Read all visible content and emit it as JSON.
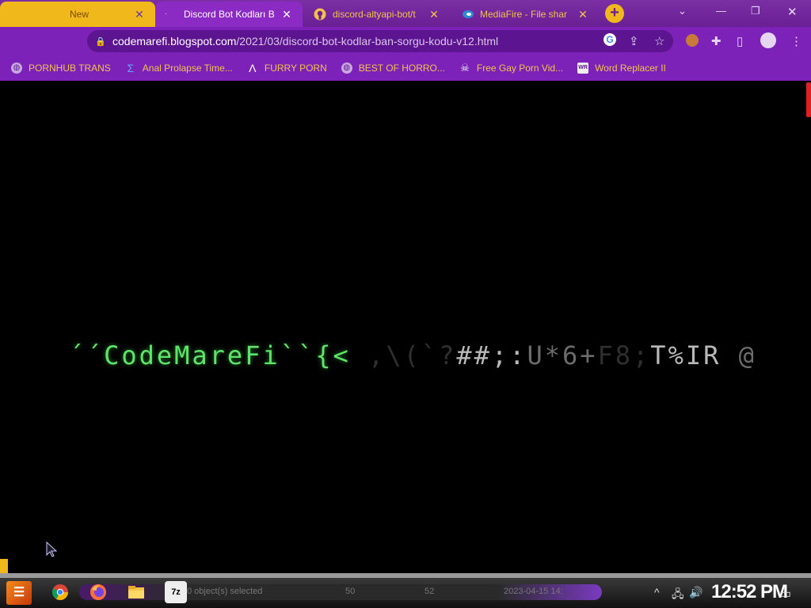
{
  "browser": {
    "tabs": [
      {
        "title": "New",
        "active": false
      },
      {
        "title": "Discord Bot Kodları B",
        "active": true
      },
      {
        "title": "discord-altyapi-bot/t",
        "active": false
      },
      {
        "title": "MediaFire - File shar",
        "active": false
      }
    ],
    "new_tab_symbol": "+",
    "close_symbol": "✕",
    "address": {
      "domain": "codemarefi.blogspot.com",
      "path": "/2021/03/discord-bot-kodlar-ban-sorgu-kodu-v12.html"
    },
    "bookmarks": [
      {
        "label": "PORNHUB TRANS",
        "icon": "globe-icon"
      },
      {
        "label": "Anal Prolapse Time...",
        "icon": "sigma-icon"
      },
      {
        "label": "FURRY PORN",
        "icon": "lambda-icon"
      },
      {
        "label": "BEST OF HORRO...",
        "icon": "globe-icon"
      },
      {
        "label": "Free Gay Porn Vid...",
        "icon": "skull-icon"
      },
      {
        "label": "Word Replacer II",
        "icon": "wr-icon"
      }
    ]
  },
  "page": {
    "code_segments": [
      {
        "text": "´´CodeMareFi``{<",
        "tone": "green"
      },
      {
        "text": " ,\\(",
        "tone": "grey2"
      },
      {
        "text": "`?",
        "tone": "grey3"
      },
      {
        "text": "##;:",
        "tone": "grey1"
      },
      {
        "text": "U*6+",
        "tone": "grey2"
      },
      {
        "text": "F8;",
        "tone": "grey3"
      },
      {
        "text": "T%IR ",
        "tone": "grey1"
      },
      {
        "text": "@",
        "tone": "grey2"
      }
    ]
  },
  "taskbar": {
    "apps": [
      "chrome",
      "firefox",
      "file-explorer",
      "7-zip"
    ],
    "sevenzip_label": "7z",
    "status_text": "0 object(s) selected",
    "status_col1": "50",
    "status_col2": "52",
    "status_date": "2023-04-15 14:",
    "clock": "12:52 PM"
  },
  "colors": {
    "tab_strip": "#6a1f94",
    "active_tab": "#8c2ac4",
    "accent_yellow": "#f1b81c",
    "code_green": "#5fe36b"
  }
}
